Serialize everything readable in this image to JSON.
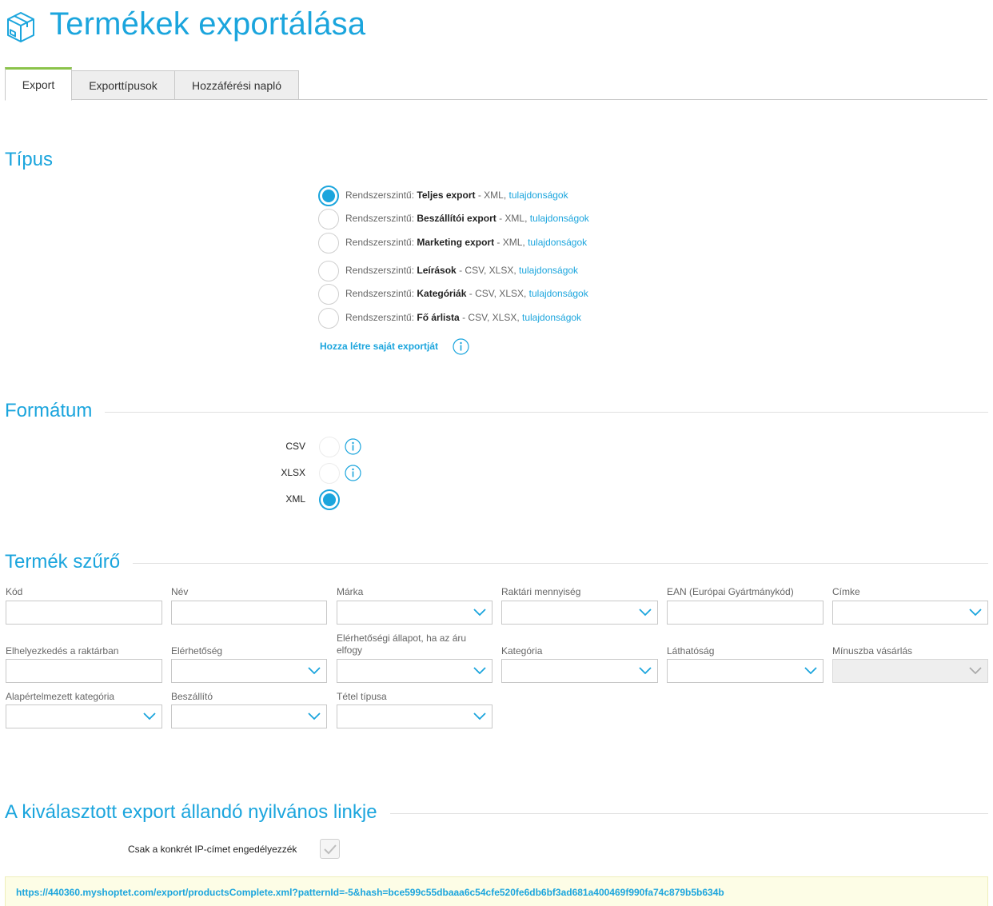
{
  "header": {
    "title": "Termékek exportálása",
    "icon": "box-icon"
  },
  "tabs": [
    {
      "label": "Export",
      "active": true
    },
    {
      "label": "Exporttípusok",
      "active": false
    },
    {
      "label": "Hozzáférési napló",
      "active": false
    }
  ],
  "type_section": {
    "title": "Típus",
    "options": [
      {
        "prefix": "Rendszerszintű: ",
        "name": "Teljes export",
        "formats": " - XML, ",
        "link": "tulajdonságok",
        "checked": true
      },
      {
        "prefix": "Rendszerszintű: ",
        "name": "Beszállítói export",
        "formats": " - XML, ",
        "link": "tulajdonságok",
        "checked": false
      },
      {
        "prefix": "Rendszerszintű: ",
        "name": "Marketing export",
        "formats": " - XML, ",
        "link": "tulajdonságok",
        "checked": false
      },
      {
        "prefix": "Rendszerszintű: ",
        "name": "Leírások",
        "formats": " - CSV, XLSX, ",
        "link": "tulajdonságok",
        "checked": false
      },
      {
        "prefix": "Rendszerszintű: ",
        "name": "Kategóriák",
        "formats": " - CSV, XLSX, ",
        "link": "tulajdonságok",
        "checked": false
      },
      {
        "prefix": "Rendszerszintű: ",
        "name": "Fő árlista",
        "formats": " - CSV, XLSX, ",
        "link": "tulajdonságok",
        "checked": false
      }
    ],
    "create_link": "Hozza létre saját exportját"
  },
  "format_section": {
    "title": "Formátum",
    "options": [
      {
        "label": "CSV",
        "checked": false,
        "info": true
      },
      {
        "label": "XLSX",
        "checked": false,
        "info": true
      },
      {
        "label": "XML",
        "checked": true,
        "info": false
      }
    ]
  },
  "filter_section": {
    "title": "Termék szűrő",
    "fields": [
      {
        "label": "Kód",
        "type": "text"
      },
      {
        "label": "Név",
        "type": "text"
      },
      {
        "label": "Márka",
        "type": "select"
      },
      {
        "label": "Raktári mennyiség",
        "type": "select"
      },
      {
        "label": "EAN (Európai Gyártmánykód)",
        "type": "text"
      },
      {
        "label": "Címke",
        "type": "select"
      },
      {
        "label": "Elhelyezkedés a raktárban",
        "type": "text"
      },
      {
        "label": "Elérhetőség",
        "type": "select"
      },
      {
        "label": "Elérhetőségi állapot, ha az áru elfogy",
        "type": "select"
      },
      {
        "label": "Kategória",
        "type": "select"
      },
      {
        "label": "Láthatóság",
        "type": "select"
      },
      {
        "label": "Mínuszba vásárlás",
        "type": "select",
        "disabled": true
      },
      {
        "label": "Alapértelmezett kategória",
        "type": "select"
      },
      {
        "label": "Beszállító",
        "type": "select"
      },
      {
        "label": "Tétel típusa",
        "type": "select"
      }
    ]
  },
  "link_section": {
    "title": "A kiválasztott export állandó nyilvános linkje",
    "ip_label": "Csak a konkrét IP-címet engedélyezzék",
    "ip_checked": true,
    "url": "https://440360.myshoptet.com/export/productsComplete.xml?patternId=-5&hash=bce599c55dbaaa6c54cfe520fe6db6bf3ad681a400469f990fa74c879b5b634b"
  },
  "colors": {
    "accent": "#1ba5dd",
    "tab_active_border": "#8bc34a",
    "url_box_bg": "#fdfde6"
  }
}
